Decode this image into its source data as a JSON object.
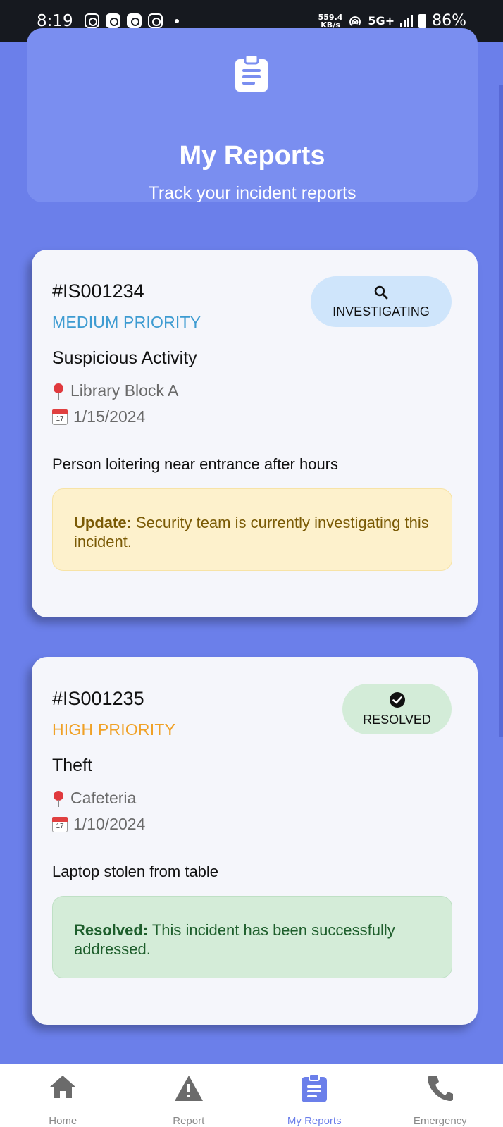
{
  "status_bar": {
    "time": "8:19",
    "speed_value": "559.4",
    "speed_unit": "KB/s",
    "network": "5G+",
    "battery": "86%",
    "icons": [
      "instagram-icon",
      "cb-icon",
      "mail-icon",
      "instagram-icon",
      "dot-icon",
      "hotspot-icon",
      "signal-icon",
      "battery-icon"
    ]
  },
  "header": {
    "icon": "clipboard-icon",
    "title": "My Reports",
    "subtitle": "Track your incident reports"
  },
  "reports": [
    {
      "id": "#IS001234",
      "priority": "MEDIUM PRIORITY",
      "priority_color": "#3d9bd1",
      "status": "INVESTIGATING",
      "status_icon": "search-icon",
      "status_color": "#cfe5fb",
      "title": "Suspicious Activity",
      "location": "Library Block A",
      "date": "1/15/2024",
      "description": "Person loitering near entrance after hours",
      "note_label": "Update:",
      "note_text": " Security team is currently investigating this incident."
    },
    {
      "id": "#IS001235",
      "priority": "HIGH PRIORITY",
      "priority_color": "#f0a126",
      "status": "RESOLVED",
      "status_icon": "check-circle-icon",
      "status_color": "#d3ecd8",
      "title": "Theft",
      "location": "Cafeteria",
      "date": "1/10/2024",
      "description": "Laptop stolen from table",
      "note_label": "Resolved:",
      "note_text": " This incident has been successfully addressed."
    }
  ],
  "nav": {
    "items": [
      {
        "label": "Home",
        "icon": "home-icon",
        "active": false
      },
      {
        "label": "Report",
        "icon": "warning-icon",
        "active": false
      },
      {
        "label": "My Reports",
        "icon": "clipboard-icon",
        "active": true
      },
      {
        "label": "Emergency",
        "icon": "phone-icon",
        "active": false
      }
    ],
    "active_color": "#6b7fea"
  },
  "colors": {
    "background": "#6b7fea",
    "header_card": "#7a8ef0",
    "card": "#f5f6fb"
  }
}
